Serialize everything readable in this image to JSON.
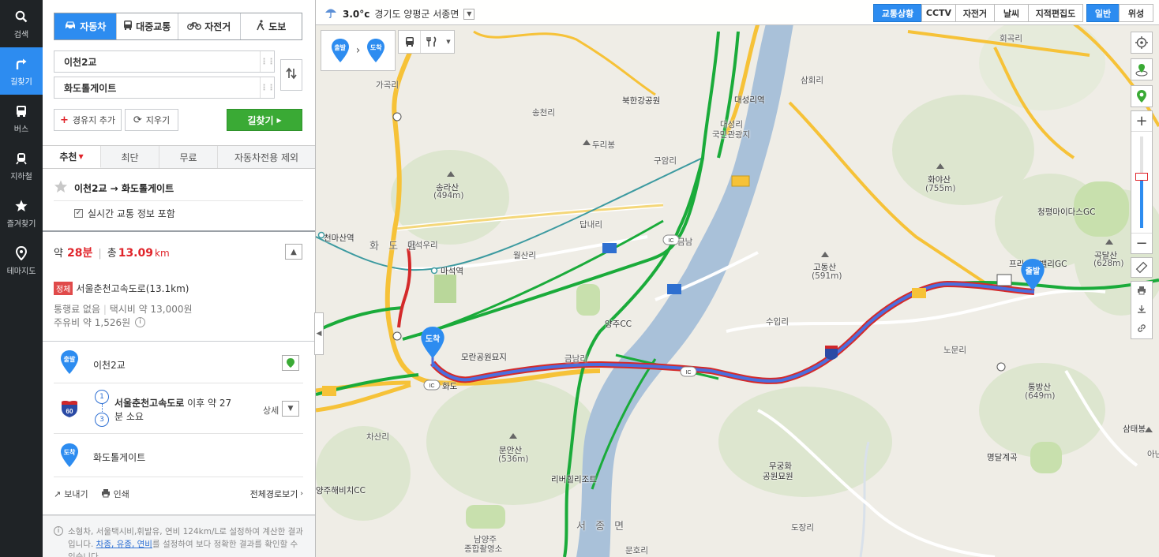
{
  "nav": [
    {
      "label": "검색",
      "icon": "search-icon"
    },
    {
      "label": "길찾기",
      "icon": "directions-icon"
    },
    {
      "label": "버스",
      "icon": "bus-icon"
    },
    {
      "label": "지하철",
      "icon": "subway-icon"
    },
    {
      "label": "즐겨찾기",
      "icon": "star-icon"
    },
    {
      "label": "테마지도",
      "icon": "pin-icon"
    }
  ],
  "modes": [
    "자동차",
    "대중교통",
    "자전거",
    "도보"
  ],
  "inputs": {
    "start": "이천2교",
    "end": "화도톨게이트"
  },
  "buttons": {
    "add_waypoint": "경유지 추가",
    "clear": "지우기",
    "find": "길찾기"
  },
  "tabs": [
    "추천",
    "최단",
    "무료",
    "자동차전용 제외"
  ],
  "route": {
    "title": "이천2교 → 화도톨게이트",
    "realtime": "실시간 교통 정보 포함",
    "approx": "약",
    "minutes": "28분",
    "total": "총",
    "distance": "13.09",
    "distance_unit": "km",
    "jam_badge": "정체",
    "road": "서울춘천고속도로(13.1km)",
    "toll": "통행료 없음",
    "taxi": "택시비 약 13,000원",
    "fuel": "주유비 약 1,526원"
  },
  "steps": {
    "start_pin": "출발",
    "start_label": "이천2교",
    "hwy_number": "60",
    "num1": "1",
    "num3": "3",
    "hwy_name": "서울춘천고속도로",
    "hwy_rest": " 이후 약 27",
    "hwy_rest2": "분 소요",
    "detail": "상세",
    "end_pin": "도착",
    "end_label": "화도톨게이트"
  },
  "footer": {
    "send": "보내기",
    "print": "인쇄",
    "full": "전체경로보기"
  },
  "note": {
    "line1": "소형차, 서울택시비,휘발유, 연비 124km/L로 설정하여 계산한 결과",
    "line2a": "입니다. ",
    "link": "차종, 유종, 연비",
    "line2b": "를 설정하여 보다 정확한 결과를 확인할 수",
    "line3": "있습니다."
  },
  "topbar": {
    "temp": "3.0°c",
    "location": "경기도 양평군 서종면",
    "buttons": [
      "교통상황",
      "CCTV",
      "자전거",
      "날씨",
      "지적편집도",
      "일반",
      "위성"
    ]
  },
  "map_labels": [
    "가곡리",
    "송천리",
    "북한강공원",
    "대성리역",
    "대성리",
    "국민관광지",
    "삼회리",
    "회곡리",
    "두리봉",
    "구암리",
    "송라산",
    "(494m)",
    "화야산",
    "(755m)",
    "청평마이다스GC",
    "천마산역",
    "화 도 읍",
    "마석우리",
    "금남",
    "답내리",
    "월산리",
    "마석역",
    "고동산",
    "(591m)",
    "곡달산",
    "(628m)",
    "프리스틴밸리GC",
    "양주CC",
    "수입리",
    "노문리",
    "모란공원묘지",
    "금남리",
    "화도",
    "통방산",
    "(649m)",
    "삼태봉",
    "차산리",
    "문안산",
    "(536m)",
    "명달계곡",
    "양주해비치CC",
    "리버힐리조트",
    "무궁화",
    "공원묘원",
    "남양주",
    "종합촬영소",
    "서 종 면",
    "도장리",
    "문호리",
    "아난"
  ],
  "colors": {
    "accent": "#2d8cf0",
    "go": "#3aaa35",
    "jam": "#e0242a"
  }
}
